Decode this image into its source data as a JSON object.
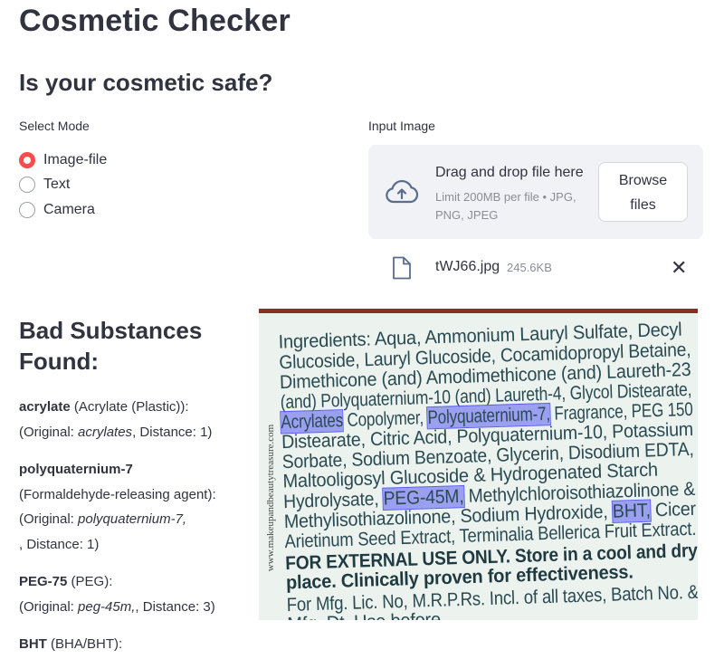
{
  "app": {
    "title": "Cosmetic Checker",
    "subtitle": "Is your cosmetic safe?"
  },
  "mode": {
    "label": "Select Mode",
    "options": [
      "Image-file",
      "Text",
      "Camera"
    ],
    "selected": "Image-file"
  },
  "uploader": {
    "label": "Input Image",
    "drag_text": "Drag and drop file here",
    "limit_text": "Limit 200MB per file • JPG, PNG, JPEG",
    "browse_line1": "Browse",
    "browse_line2": "files",
    "file_name": "tWJ66.jpg",
    "file_size": "245.6KB",
    "close_glyph": "✕"
  },
  "results": {
    "title": "Bad Substances Found:",
    "findings": [
      {
        "name": "acrylate",
        "category": "(Acrylate (Plastic)):",
        "original_label": "(Original: ",
        "original": "acrylates",
        "distance": ", Distance: 1)"
      },
      {
        "name": "polyquaternium-7",
        "category": "(Formaldehyde-releasing agent):",
        "original_label": "(Original: ",
        "original": "polyquaternium-7,",
        "distance": ", Distance: 1)"
      },
      {
        "name": "PEG-75",
        "category": "(PEG):",
        "original_label": "(Original: ",
        "original": "peg-45m,",
        "distance": ", Distance: 3)"
      },
      {
        "name": "BHT",
        "category": "(BHA/BHT):"
      }
    ]
  },
  "photo": {
    "watermark": "www.makeupandbeautytreasure.com",
    "lines": [
      "Ingredients: Aqua, Ammonium Lauryl Sulfate, Decyl",
      "Glucoside, Lauryl Glucoside, Cocamidopropyl Betaine,",
      "Dimethicone (and) Amodimethicone (and) Laureth-23",
      "(and) Polyquaternium-10 (and) Laureth-4, Glycol Distearate,",
      "Copolymer,",
      "Fragrance, PEG 150",
      "Distearate, Citric Acid, Polyquaternium-10, Potassium",
      "Sorbate, Sodium Benzoate, Glycerin, Disodium EDTA,",
      "Maltooligosyl Glucoside & Hydrogenated Starch",
      "Hydrolysate,",
      "Methylchloroisothiazolinone &",
      "Methylisothiazolinone, Sodium Hydroxide,",
      "Cicer",
      "Arietinum Seed Extract, Terminalia Bellerica Fruit Extract.",
      "FOR EXTERNAL USE ONLY. Store in a cool and dry",
      "place. Clinically proven for effectiveness.",
      "For Mfg. Lic. No, M.R.P.Rs. Incl. of all taxes, Batch No. &",
      "Mfg. Dt. Use before"
    ],
    "highlights": [
      "Acrylates",
      "Polyquaternium-7,",
      "PEG-45M,",
      "BHT,"
    ],
    "highlight_color": "#5a5ef0"
  },
  "colors": {
    "accent": "#ff4b4b",
    "dropzone_bg": "#f0f2f6",
    "text": "#31333f"
  }
}
